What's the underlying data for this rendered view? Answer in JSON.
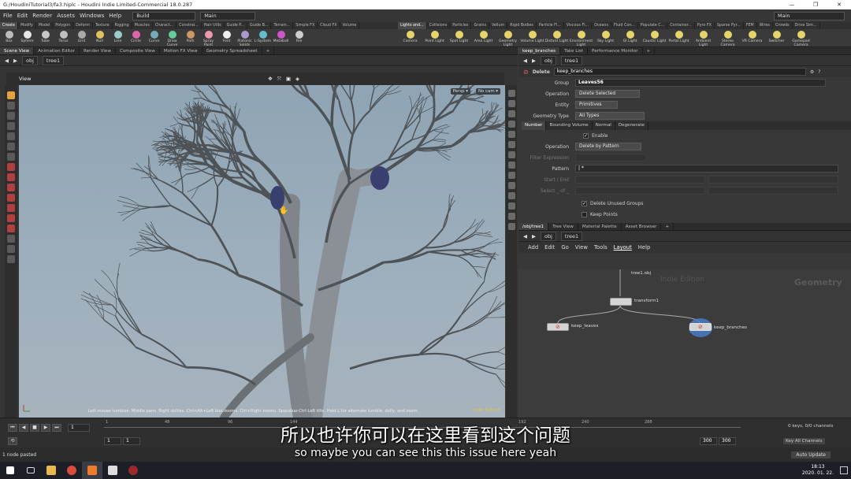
{
  "window": {
    "title": "G:/HoudiniTutorial3/fa3.hiplc - Houdini Indie Limited-Commercial 18.0.287",
    "controls": [
      "—",
      "❐",
      "✕"
    ]
  },
  "menu": {
    "items": [
      "File",
      "Edit",
      "Render",
      "Assets",
      "Windows",
      "Help"
    ],
    "build": "Build",
    "desktop": "Main",
    "desktop_right": "Main"
  },
  "shelf_tabs_left": [
    "Create",
    "Modify",
    "Model",
    "Polygon",
    "Deform",
    "Texture",
    "Rigging",
    "Muscles",
    "Charact...",
    "Constrai...",
    "Hair Utils",
    "Guide P...",
    "Guide B...",
    "Terrain...",
    "Simple FX",
    "Cloud FX",
    "Volume"
  ],
  "shelf_tabs_right": [
    "Lights and...",
    "Collisions",
    "Particles",
    "Grains",
    "Vellum",
    "Rigid Bodies",
    "Particle Fl...",
    "Viscous Fl...",
    "Oceans",
    "Fluid Con...",
    "Populate C...",
    "Container...",
    "Pyro FX",
    "Sparse Pyr...",
    "FEM",
    "Wires",
    "Crowds",
    "Drive Sim..."
  ],
  "shelf_tools_left": [
    "Box",
    "Sphere",
    "Tube",
    "Torus",
    "Grid",
    "Null",
    "Line",
    "Circle",
    "Curve",
    "Draw Curve",
    "Path",
    "Spray Paint",
    "Font",
    "Platonic Solids",
    "L-System",
    "Metaball",
    "File"
  ],
  "shelf_tools_right": [
    "Camera",
    "Point Light",
    "Spot Light",
    "Area Light",
    "Geometry Light",
    "Volume Light",
    "Distant Light",
    "Environment Light",
    "Sky Light",
    "GI Light",
    "Caustic Light",
    "Portal Light",
    "Ambient Light",
    "Stereo Camera",
    "VR Camera",
    "Switcher",
    "Gamepad Camera"
  ],
  "colors": {
    "accent": "#e7c53f",
    "node_selected": "#4a7fd0",
    "viewport_bg": "#98aab7"
  },
  "left_pane": {
    "tabs": [
      "Scene View",
      "Animation Editor",
      "Render View",
      "Composite View",
      "Motion FX View",
      "Geometry Spreadsheet"
    ],
    "path": [
      "obj",
      "tree1"
    ],
    "view_label": "View",
    "persp": "Persp ▾",
    "cam": "No cam ▾",
    "hint": "Left mouse tumbles. Middle pans. Right dollies. Ctrl+Alt+Left box-zooms. Ctrl+Right zooms. Spacebar-Ctrl-Left tilts. Hold L for alternate tumble, dolly, and zoom.",
    "indie": "Indie Edition"
  },
  "param_pane": {
    "tabs": [
      "keep_branches",
      "Take List",
      "Performance Monitor"
    ],
    "path": [
      "obj",
      "tree1"
    ],
    "node_type": "Delete",
    "node_name": "keep_branches",
    "group_label": "Group",
    "group_value": "Leaves56",
    "operation_label": "Operation",
    "operation_value": "Delete Selected",
    "entity_label": "Entity",
    "entity_value": "Primitives",
    "geotype_label": "Geometry Type",
    "geotype_value": "All Types",
    "subtabs": [
      "Number",
      "Bounding Volume",
      "Normal",
      "Degenerate"
    ],
    "enable_label": "Enable",
    "op2_label": "Operation",
    "op2_value": "Delete by Pattern",
    "filter_label": "Filter Expression",
    "pattern_label": "Pattern",
    "pattern_value": "| *",
    "startend_label": "Start / End",
    "select_label": "Select _ of _",
    "delete_unused_label": "Delete Unused Groups",
    "keep_points_label": "Keep Points"
  },
  "network_pane": {
    "tabs": [
      "/obj/tree1",
      "Tree View",
      "Material Palette",
      "Asset Browser"
    ],
    "path": [
      "obj",
      "tree1"
    ],
    "menu": [
      "Add",
      "Edit",
      "Go",
      "View",
      "Tools",
      "Layout",
      "Help"
    ],
    "indie": "Indie Edition",
    "context": "Geometry",
    "nodes": {
      "top": "tree1.obj",
      "transform": "transform1",
      "keep_leaves": "keep_leaves",
      "keep_branches": "keep_branches"
    }
  },
  "timeline": {
    "frame": "1",
    "start": "1",
    "start2": "1",
    "end": "300",
    "end2": "300",
    "ticks": [
      "1",
      "48",
      "96",
      "144",
      "192",
      "240",
      "288"
    ],
    "keys": "0 keys, 0/0 channels",
    "key_all": "Key All Channels",
    "auto_update": "Auto Update"
  },
  "subtitle": {
    "zh": "所以也许你可以在这里看到这个问题",
    "en": "so maybe you can see this this issue here yeah"
  },
  "status": {
    "text": "1 node pasted"
  },
  "taskbar": {
    "time": "18:13",
    "date": "2020. 01. 22."
  }
}
